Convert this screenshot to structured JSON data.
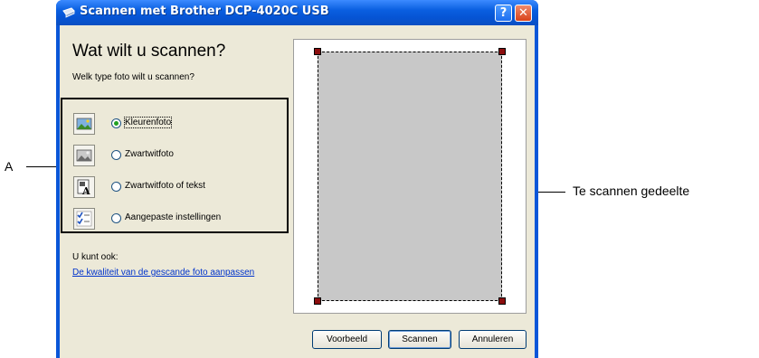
{
  "window": {
    "title": "Scannen met Brother DCP-4020C USB",
    "help_btn": "?",
    "close_btn": "✕"
  },
  "panel": {
    "title": "Wat wilt u scannen?",
    "subtitle": "Welk type foto wilt u scannen?",
    "options": [
      {
        "label": "Kleurenfoto",
        "checked": true,
        "icon": "color-photo-icon"
      },
      {
        "label": "Zwartwitfoto",
        "checked": false,
        "icon": "grayscale-photo-icon"
      },
      {
        "label": "Zwartwitfoto of tekst",
        "checked": false,
        "icon": "bw-text-icon"
      },
      {
        "label": "Aangepaste instellingen",
        "checked": false,
        "icon": "custom-settings-icon"
      }
    ],
    "also_label": "U kunt ook:",
    "quality_link": "De kwaliteit van de gescande foto aanpassen"
  },
  "buttons": {
    "preview": "Voorbeeld",
    "scan": "Scannen",
    "cancel": "Annuleren"
  },
  "annotations": {
    "a_label": "A",
    "scan_area_label": "Te scannen gedeelte"
  }
}
